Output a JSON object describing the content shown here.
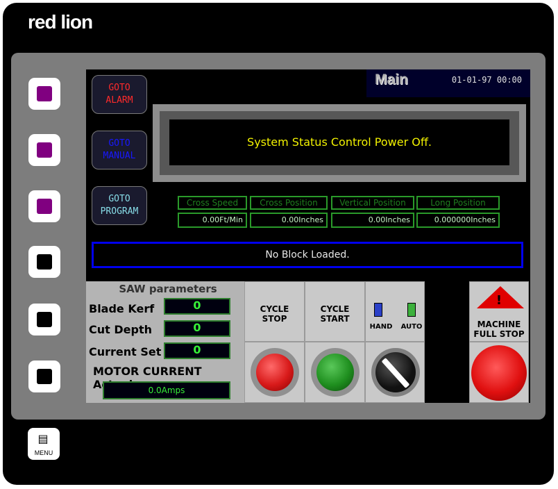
{
  "brand": {
    "logo": "red lion"
  },
  "screen": {
    "title": "Main",
    "datetime": "01-01-97 00:00",
    "goto_buttons": [
      {
        "label_line1": "GOTO",
        "label_line2": "ALARM",
        "color": "#ff2a2a"
      },
      {
        "label_line1": "GOTO",
        "label_line2": "MANUAL",
        "color": "#1818ff"
      },
      {
        "label_line1": "GOTO",
        "label_line2": "PROGRAM",
        "color": "#88dde8"
      }
    ],
    "status_message": "System Status Control Power Off.",
    "positions": [
      {
        "label": "Cross Speed",
        "value": "0.00Ft/Min"
      },
      {
        "label": "Cross Position",
        "value": "0.00Inches"
      },
      {
        "label": "Vertical Position",
        "value": "0.00Inches"
      },
      {
        "label": "Long Position",
        "value": "0.000000Inches"
      }
    ],
    "block_status": "No Block Loaded.",
    "saw": {
      "title": "SAW parameters",
      "blade_kerf_label": "Blade Kerf",
      "blade_kerf_value": "0",
      "cut_depth_label": "Cut Depth",
      "cut_depth_value": "0",
      "current_set_label": "Current Set",
      "current_set_value": "0",
      "motor_current_label": "MOTOR CURRENT Actual",
      "motor_current_value": "0.0Amps"
    },
    "controls": {
      "cycle_stop_line1": "CYCLE",
      "cycle_stop_line2": "STOP",
      "cycle_start_line1": "CYCLE",
      "cycle_start_line2": "START",
      "hand_label": "HAND",
      "auto_label": "AUTO",
      "machine_stop_line1": "MACHINE",
      "machine_stop_line2": "FULL STOP",
      "warning_mark": "!"
    }
  },
  "softkeys": [
    {
      "state": "active",
      "color": "#800080"
    },
    {
      "state": "active",
      "color": "#800080"
    },
    {
      "state": "active",
      "color": "#800080"
    },
    {
      "state": "inactive",
      "color": "#000000"
    },
    {
      "state": "inactive",
      "color": "#000000"
    },
    {
      "state": "inactive",
      "color": "#000000"
    }
  ],
  "menu_button": {
    "label": "MENU",
    "icon": "menu-list-icon"
  },
  "colors": {
    "status_text": "#f2f200",
    "field_green": "#37f037",
    "block_border": "#0000ee",
    "hand_indicator": "#2a40c8",
    "auto_indicator": "#3cb03c"
  }
}
